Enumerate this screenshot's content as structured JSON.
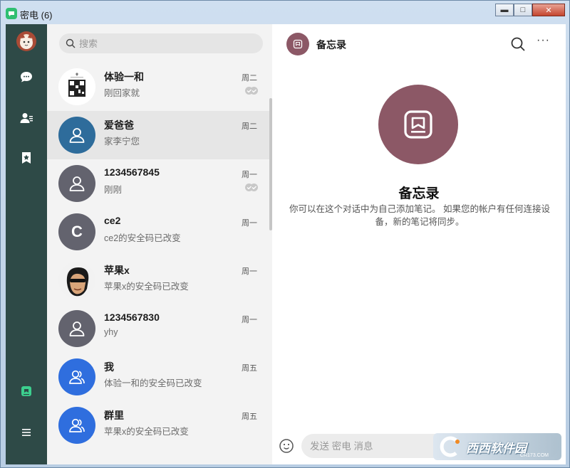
{
  "window": {
    "title": "密电 (6)",
    "buttons": {
      "minimize": "▬",
      "maximize": "□",
      "close": "✕"
    }
  },
  "rail": {
    "icons": [
      "user-avatar",
      "chat-bubble-icon",
      "contacts-icon",
      "bookmark-star-icon",
      "notes-icon",
      "menu-icon"
    ]
  },
  "search": {
    "placeholder": "搜索"
  },
  "chats": [
    {
      "name": "体验一和",
      "preview": "刚回家就",
      "time": "周二",
      "avatar": "qr",
      "read": true
    },
    {
      "name": "爱爸爸",
      "preview": "家李宁您",
      "time": "周二",
      "avatar": "person",
      "color": "#2e6c9b",
      "active": true
    },
    {
      "name": "1234567845",
      "preview": "刚刚",
      "time": "周一",
      "avatar": "person",
      "color": "#63636e",
      "read": true
    },
    {
      "name": "ce2",
      "preview": "ce2的安全码已改变",
      "time": "周一",
      "avatar": "letter",
      "letter": "C",
      "color": "#63636e"
    },
    {
      "name": "苹果x",
      "preview": "苹果x的安全码已改变",
      "time": "周一",
      "avatar": "photo"
    },
    {
      "name": "1234567830",
      "preview": "yhy",
      "time": "周一",
      "avatar": "person",
      "color": "#63636e"
    },
    {
      "name": "我",
      "preview": "体验一和的安全码已改变",
      "time": "周五",
      "avatar": "group",
      "color": "#2f6ede"
    },
    {
      "name": "群里",
      "preview": "苹果x的安全码已改变",
      "time": "周五",
      "avatar": "group",
      "color": "#2f6ede"
    }
  ],
  "main": {
    "header_title": "备忘录",
    "title": "备忘录",
    "description": "你可以在这个对话中为自己添加笔记。 如果您的帐户有任何连接设备，新的笔记将同步。",
    "input_placeholder": "发送 密电 消息"
  },
  "watermark": {
    "text": "西西软件园",
    "sub": "CR173.COM"
  },
  "colors": {
    "rail": "#2e4a47",
    "accent": "#2fbf71",
    "notes": "#8c5866",
    "blue": "#2f6ede"
  }
}
